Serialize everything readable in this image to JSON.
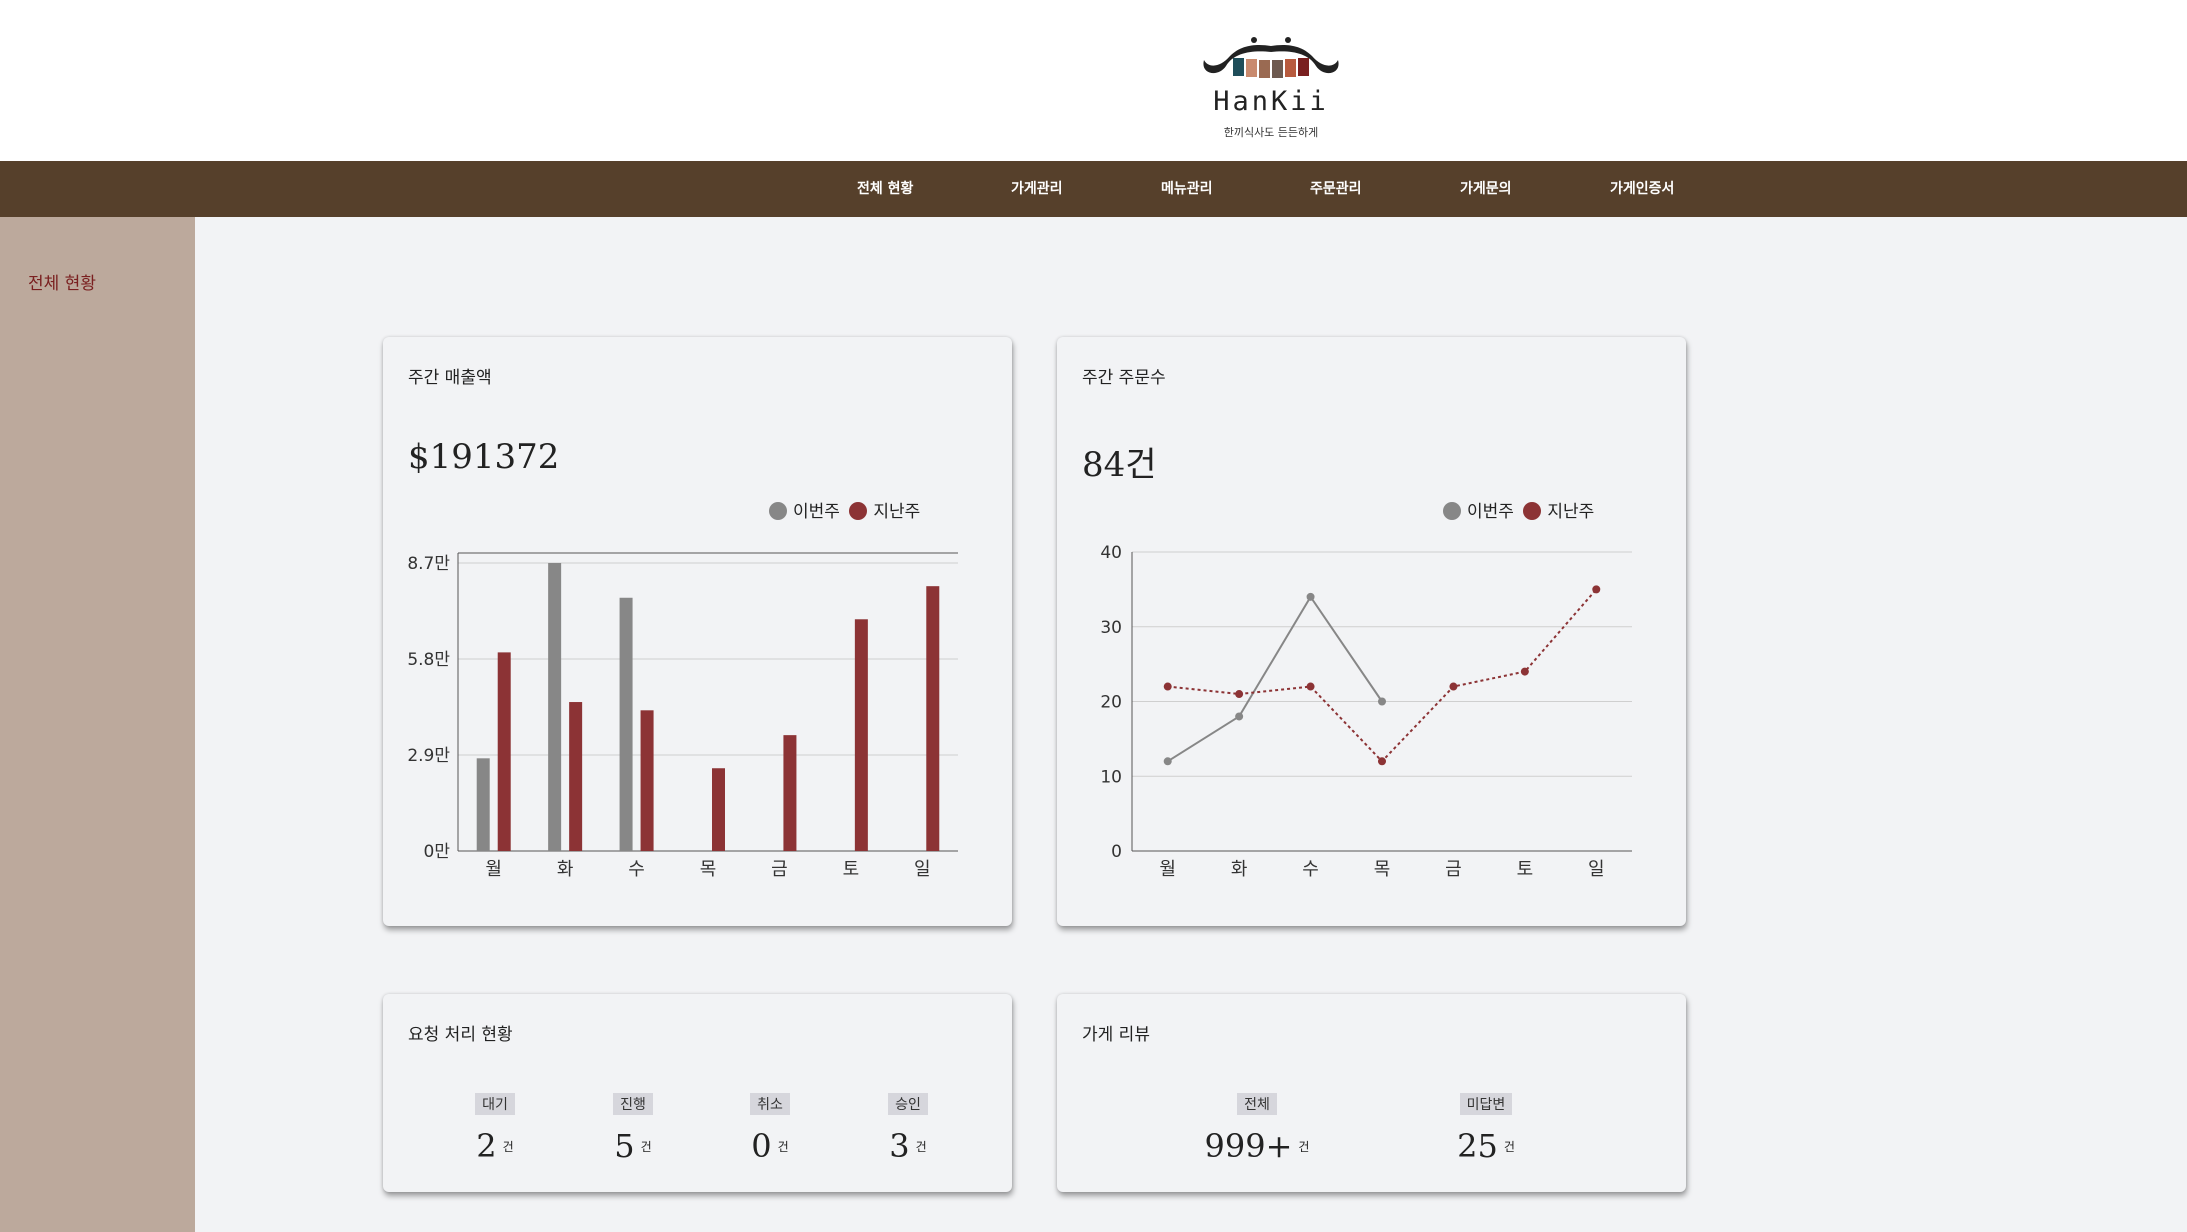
{
  "brand": {
    "name": "HanKii",
    "tagline": "한끼식사도 든든하게"
  },
  "nav": {
    "items": [
      "전체 현황",
      "가게관리",
      "메뉴관리",
      "주문관리",
      "가게문의",
      "가게인증서"
    ]
  },
  "sidebar": {
    "items": [
      "전체 현황"
    ]
  },
  "colors": {
    "header_bg": "#ffffff",
    "nav_bg": "#56402b",
    "sidebar_bg": "#bca99c",
    "this_week": "#878787",
    "last_week": "#8c3335"
  },
  "weekly_sales": {
    "title": "주간 매출액",
    "total": "$191372",
    "legend": [
      "이번주",
      "지난주"
    ]
  },
  "weekly_orders": {
    "title": "주간 주문수",
    "total": "84건",
    "legend": [
      "이번주",
      "지난주"
    ]
  },
  "requests": {
    "title": "요청 처리 현황",
    "unit": "건",
    "items": [
      {
        "label": "대기",
        "value": "2"
      },
      {
        "label": "진행",
        "value": "5"
      },
      {
        "label": "취소",
        "value": "0"
      },
      {
        "label": "승인",
        "value": "3"
      }
    ]
  },
  "reviews": {
    "title": "가게 리뷰",
    "unit": "건",
    "items": [
      {
        "label": "전체",
        "value": "999+"
      },
      {
        "label": "미답변",
        "value": "25"
      }
    ]
  },
  "chart_data": [
    {
      "type": "bar",
      "categories": [
        "월",
        "화",
        "수",
        "목",
        "금",
        "토",
        "일"
      ],
      "ylim": [
        0,
        87000
      ],
      "yticks": [
        0,
        29000,
        58000,
        87000
      ],
      "ytick_labels": [
        "0만",
        "2.9만",
        "5.8만",
        "8.7만"
      ],
      "legend": "top-right",
      "series": [
        {
          "name": "이번주",
          "color": "#878787",
          "values": [
            28000,
            87000,
            76500,
            null,
            null,
            null,
            null
          ]
        },
        {
          "name": "지난주",
          "color": "#8c3335",
          "values": [
            60000,
            45000,
            42500,
            25000,
            35000,
            70000,
            80000
          ]
        }
      ]
    },
    {
      "type": "line",
      "categories": [
        "월",
        "화",
        "수",
        "목",
        "금",
        "토",
        "일"
      ],
      "ylim": [
        0,
        40
      ],
      "yticks": [
        0,
        10,
        20,
        30,
        40
      ],
      "legend": "top-right",
      "series": [
        {
          "name": "이번주",
          "color": "#878787",
          "values": [
            12,
            18,
            34,
            20,
            null,
            null,
            null
          ]
        },
        {
          "name": "지난주",
          "color": "#8c3335",
          "values": [
            22,
            21,
            22,
            12,
            22,
            24,
            35
          ]
        }
      ]
    }
  ]
}
